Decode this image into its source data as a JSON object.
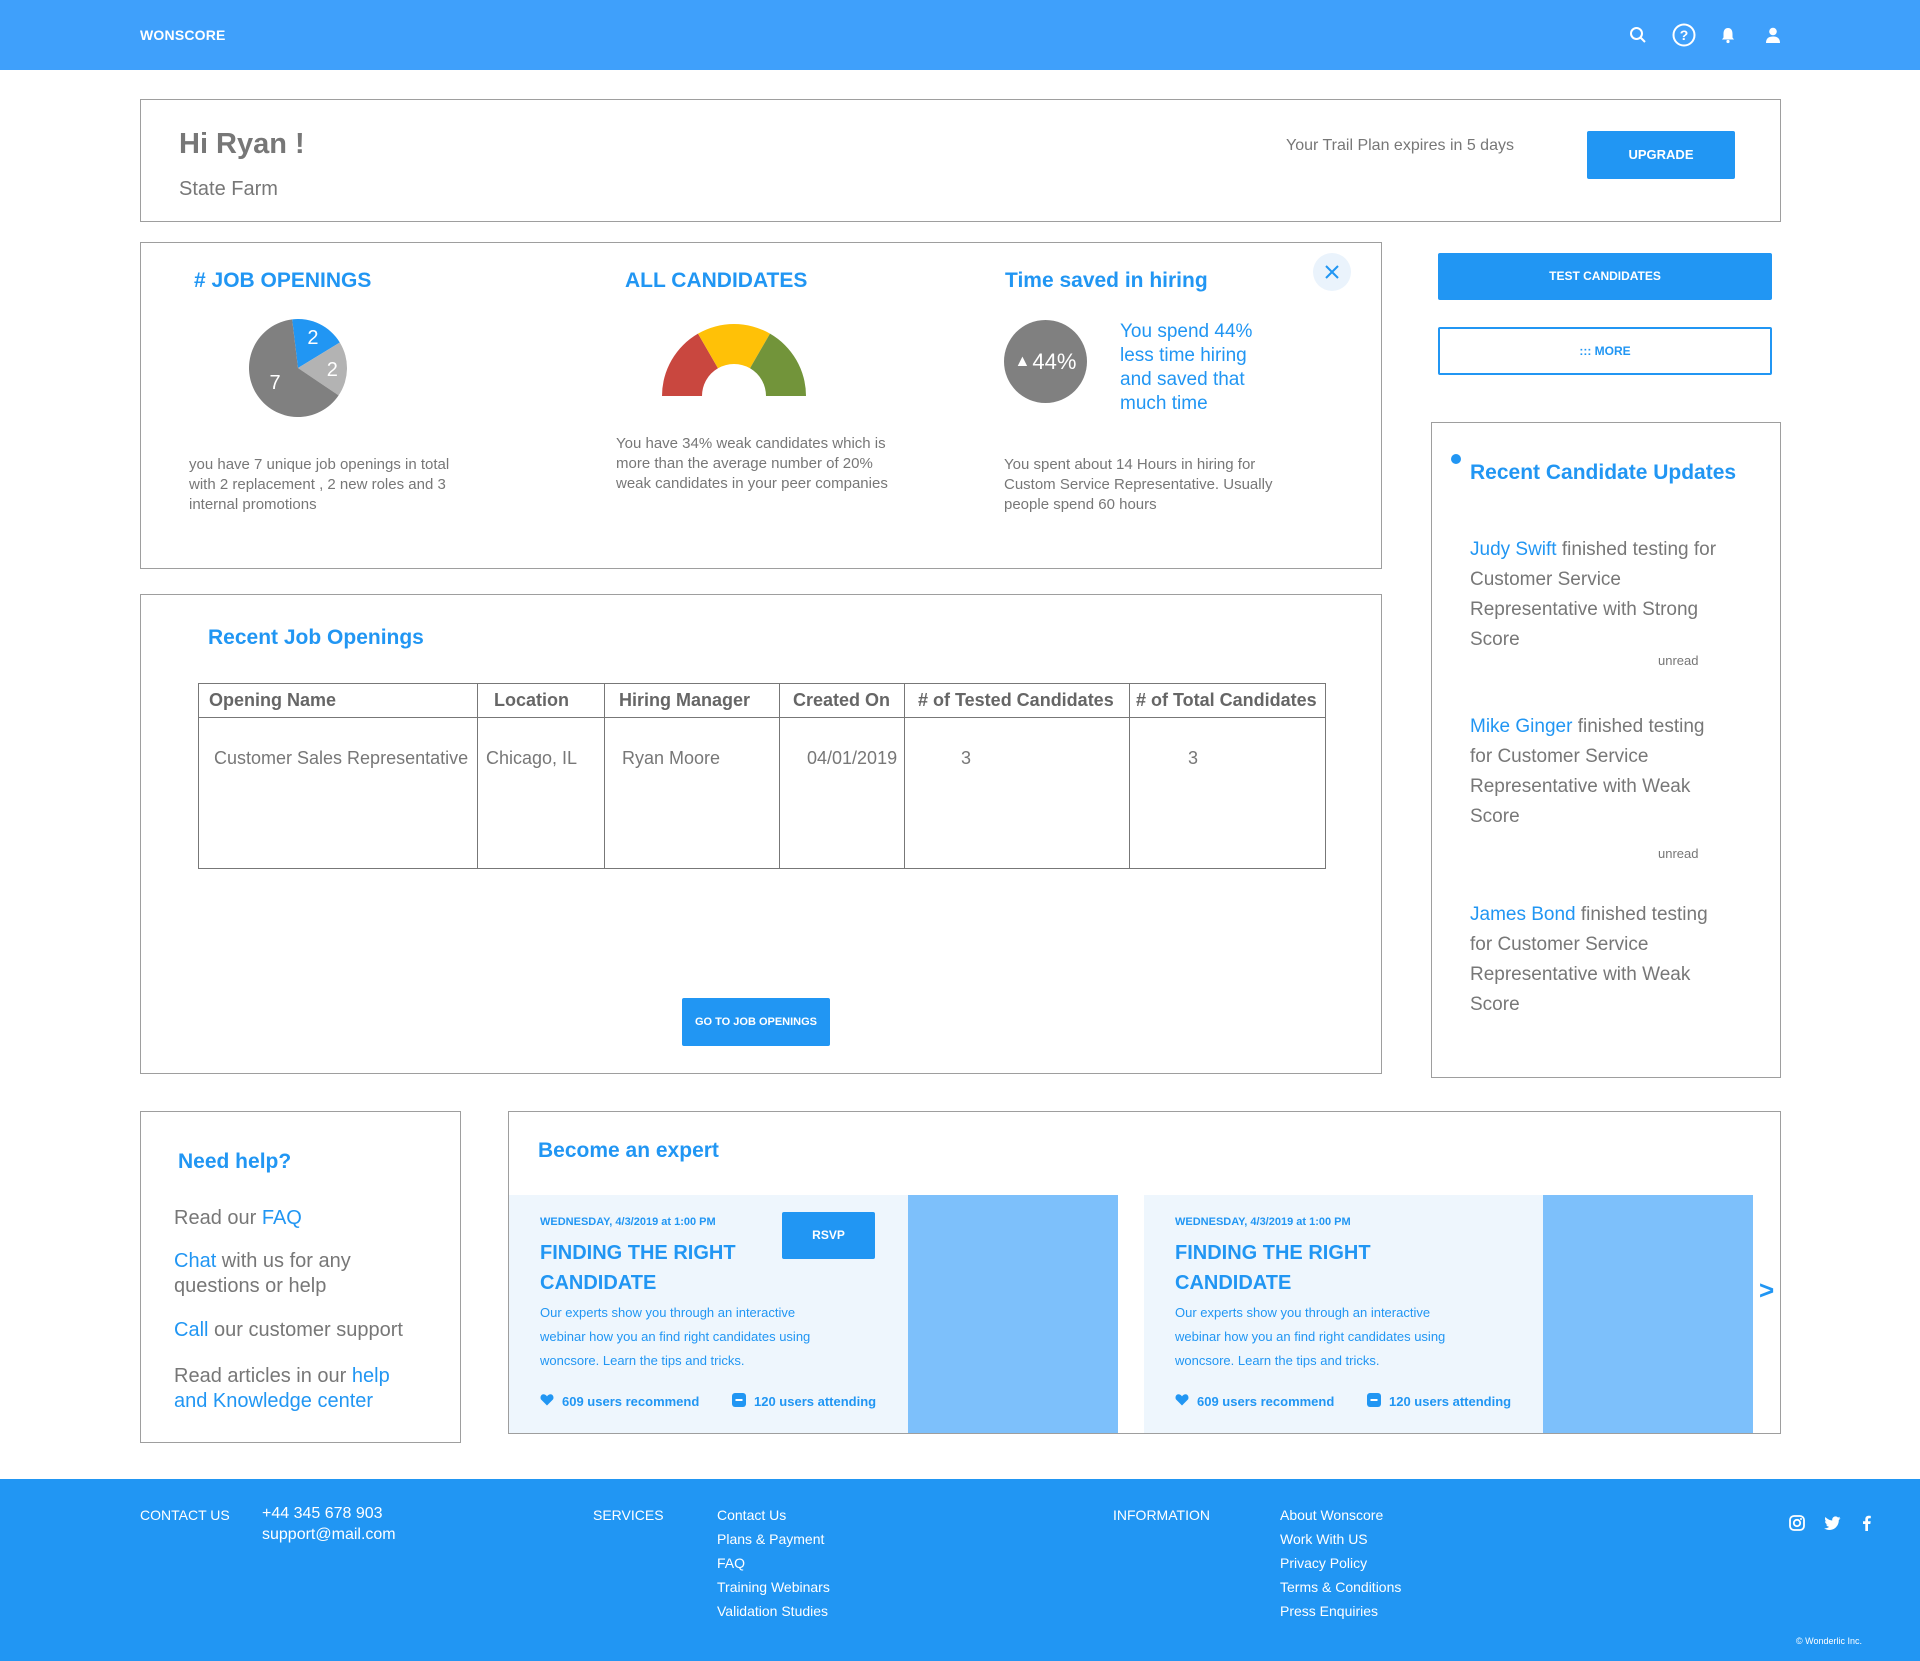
{
  "app": {
    "brand": "WONSCORE"
  },
  "greeting": {
    "title": "Hi Ryan !",
    "company": "State Farm",
    "trial_text": "Your Trail Plan expires in 5 days",
    "upgrade_label": "UPGRADE"
  },
  "stats": {
    "job_openings": {
      "title": "# JOB OPENINGS",
      "pie": [
        {
          "label": "7",
          "value": 7,
          "color": "#808080"
        },
        {
          "label": "2",
          "value": 2,
          "color": "#2196f3"
        },
        {
          "label": "2",
          "value": 2,
          "color": "#b3b3b3"
        }
      ],
      "description": "you have 7 unique job openings in total with 2 replacement , 2 new roles and 3 internal promotions"
    },
    "all_candidates": {
      "title": "ALL CANDIDATES",
      "gauge_colors": [
        "#c9473f",
        "#ffc107",
        "#72943a"
      ],
      "description": "You have 34% weak candidates which is more than the average number of 20% weak candidates in your peer companies"
    },
    "time_saved": {
      "title": "Time saved  in hiring",
      "percent": "44%",
      "highlight": "You spend 44% less time hiring and saved that much time",
      "description": "You spent about 14 Hours in hiring for Custom Service Representative. Usually people spend 60 hours"
    }
  },
  "actions": {
    "test_candidates": "TEST CANDIDATES",
    "more": "::: MORE"
  },
  "job_openings": {
    "title": "Recent Job Openings",
    "columns": [
      "Opening Name",
      "Location",
      "Hiring Manager",
      "Created On",
      "# of Tested Candidates",
      "# of Total Candidates"
    ],
    "rows": [
      [
        "Customer Sales Representative",
        "Chicago, IL",
        "Ryan Moore",
        "04/01/2019",
        "3",
        "3"
      ]
    ],
    "go_label": "GO TO JOB OPENINGS"
  },
  "updates": {
    "title": "Recent Candidate Updates",
    "items": [
      {
        "name": "Judy Swift",
        "text": " finished testing for Customer Service Representative with Strong Score",
        "status": "unread"
      },
      {
        "name": "Mike Ginger",
        "text": " finished testing for Customer Service Representative with Weak Score",
        "status": "unread"
      },
      {
        "name": "James Bond",
        "text": " finished testing for Customer Service Representative with Weak Score",
        "status": ""
      }
    ]
  },
  "help": {
    "title": "Need help?",
    "faq_prefix": "Read our ",
    "faq_link": "FAQ",
    "chat_link": "Chat",
    "chat_suffix": " with us for any questions or help",
    "call_link": "Call",
    "call_suffix": " our customer support",
    "articles_prefix": "Read articles in our ",
    "articles_link": "help and Knowledge center"
  },
  "expert": {
    "title": "Become an expert",
    "webinars": [
      {
        "date": "WEDNESDAY, 4/3/2019 at 1:00 PM",
        "title": "FINDING THE RIGHT CANDIDATE",
        "description": "Our experts show you through an interactive webinar how you an find right candidates using woncsore. Learn the tips and tricks.",
        "recommend": "609 users recommend",
        "attending": "120 users attending",
        "rsvp": "RSVP"
      },
      {
        "date": "WEDNESDAY, 4/3/2019 at 1:00 PM",
        "title": "FINDING THE RIGHT CANDIDATE",
        "description": "Our experts show you through an interactive webinar how you an find right candidates using woncsore. Learn the tips and tricks.",
        "recommend": "609 users recommend",
        "attending": "120 users attending"
      }
    ],
    "next": ">"
  },
  "footer": {
    "contact_heading": "CONTACT US",
    "phone": "+44 345 678 903",
    "email": "support@mail.com",
    "services_heading": "SERVICES",
    "services": [
      "Contact Us",
      "Plans & Payment",
      "FAQ",
      "Training Webinars",
      "Validation Studies"
    ],
    "information_heading": "INFORMATION",
    "information": [
      "About Wonscore",
      "Work With US",
      "Privacy Policy",
      "Terms & Conditions",
      "Press Enquiries"
    ],
    "copyright": "© Wonderlic Inc."
  },
  "icons": [
    "search-icon",
    "help-icon",
    "bell-icon",
    "user-icon",
    "close-icon",
    "heart-icon",
    "minus-badge-icon",
    "instagram-icon",
    "twitter-icon",
    "facebook-icon"
  ]
}
